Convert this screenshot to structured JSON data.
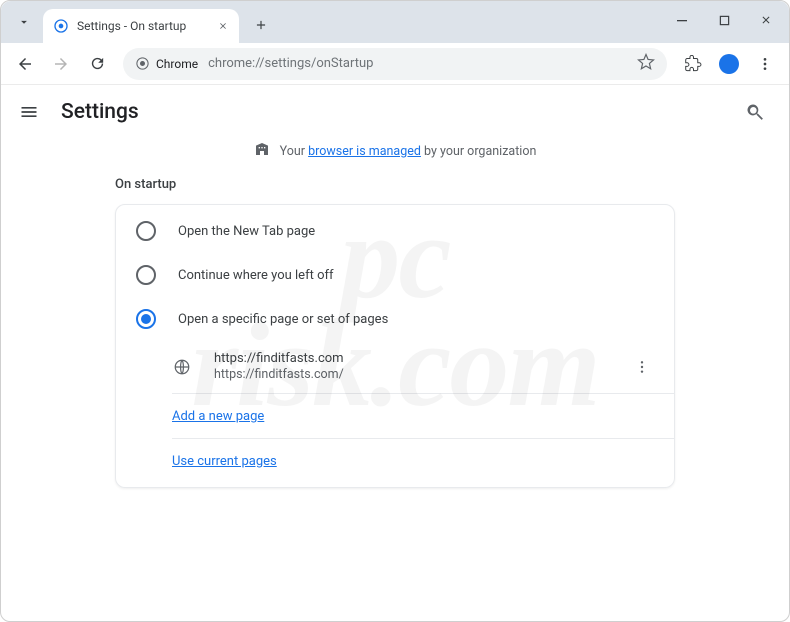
{
  "window": {
    "tab_title": "Settings - On startup"
  },
  "toolbar": {
    "chip_label": "Chrome",
    "url": "chrome://settings/onStartup"
  },
  "header": {
    "title": "Settings"
  },
  "banner": {
    "prefix": "Your ",
    "link": "browser is managed",
    "suffix": " by your organization"
  },
  "section": {
    "heading": "On startup"
  },
  "options": [
    {
      "label": "Open the New Tab page",
      "selected": false
    },
    {
      "label": "Continue where you left off",
      "selected": false
    },
    {
      "label": "Open a specific page or set of pages",
      "selected": true
    }
  ],
  "site": {
    "title": "https://finditfasts.com",
    "url": "https://finditfasts.com/"
  },
  "links": {
    "add_page": "Add a new page",
    "use_current": "Use current pages"
  },
  "watermark": "pc\nrisk.com"
}
